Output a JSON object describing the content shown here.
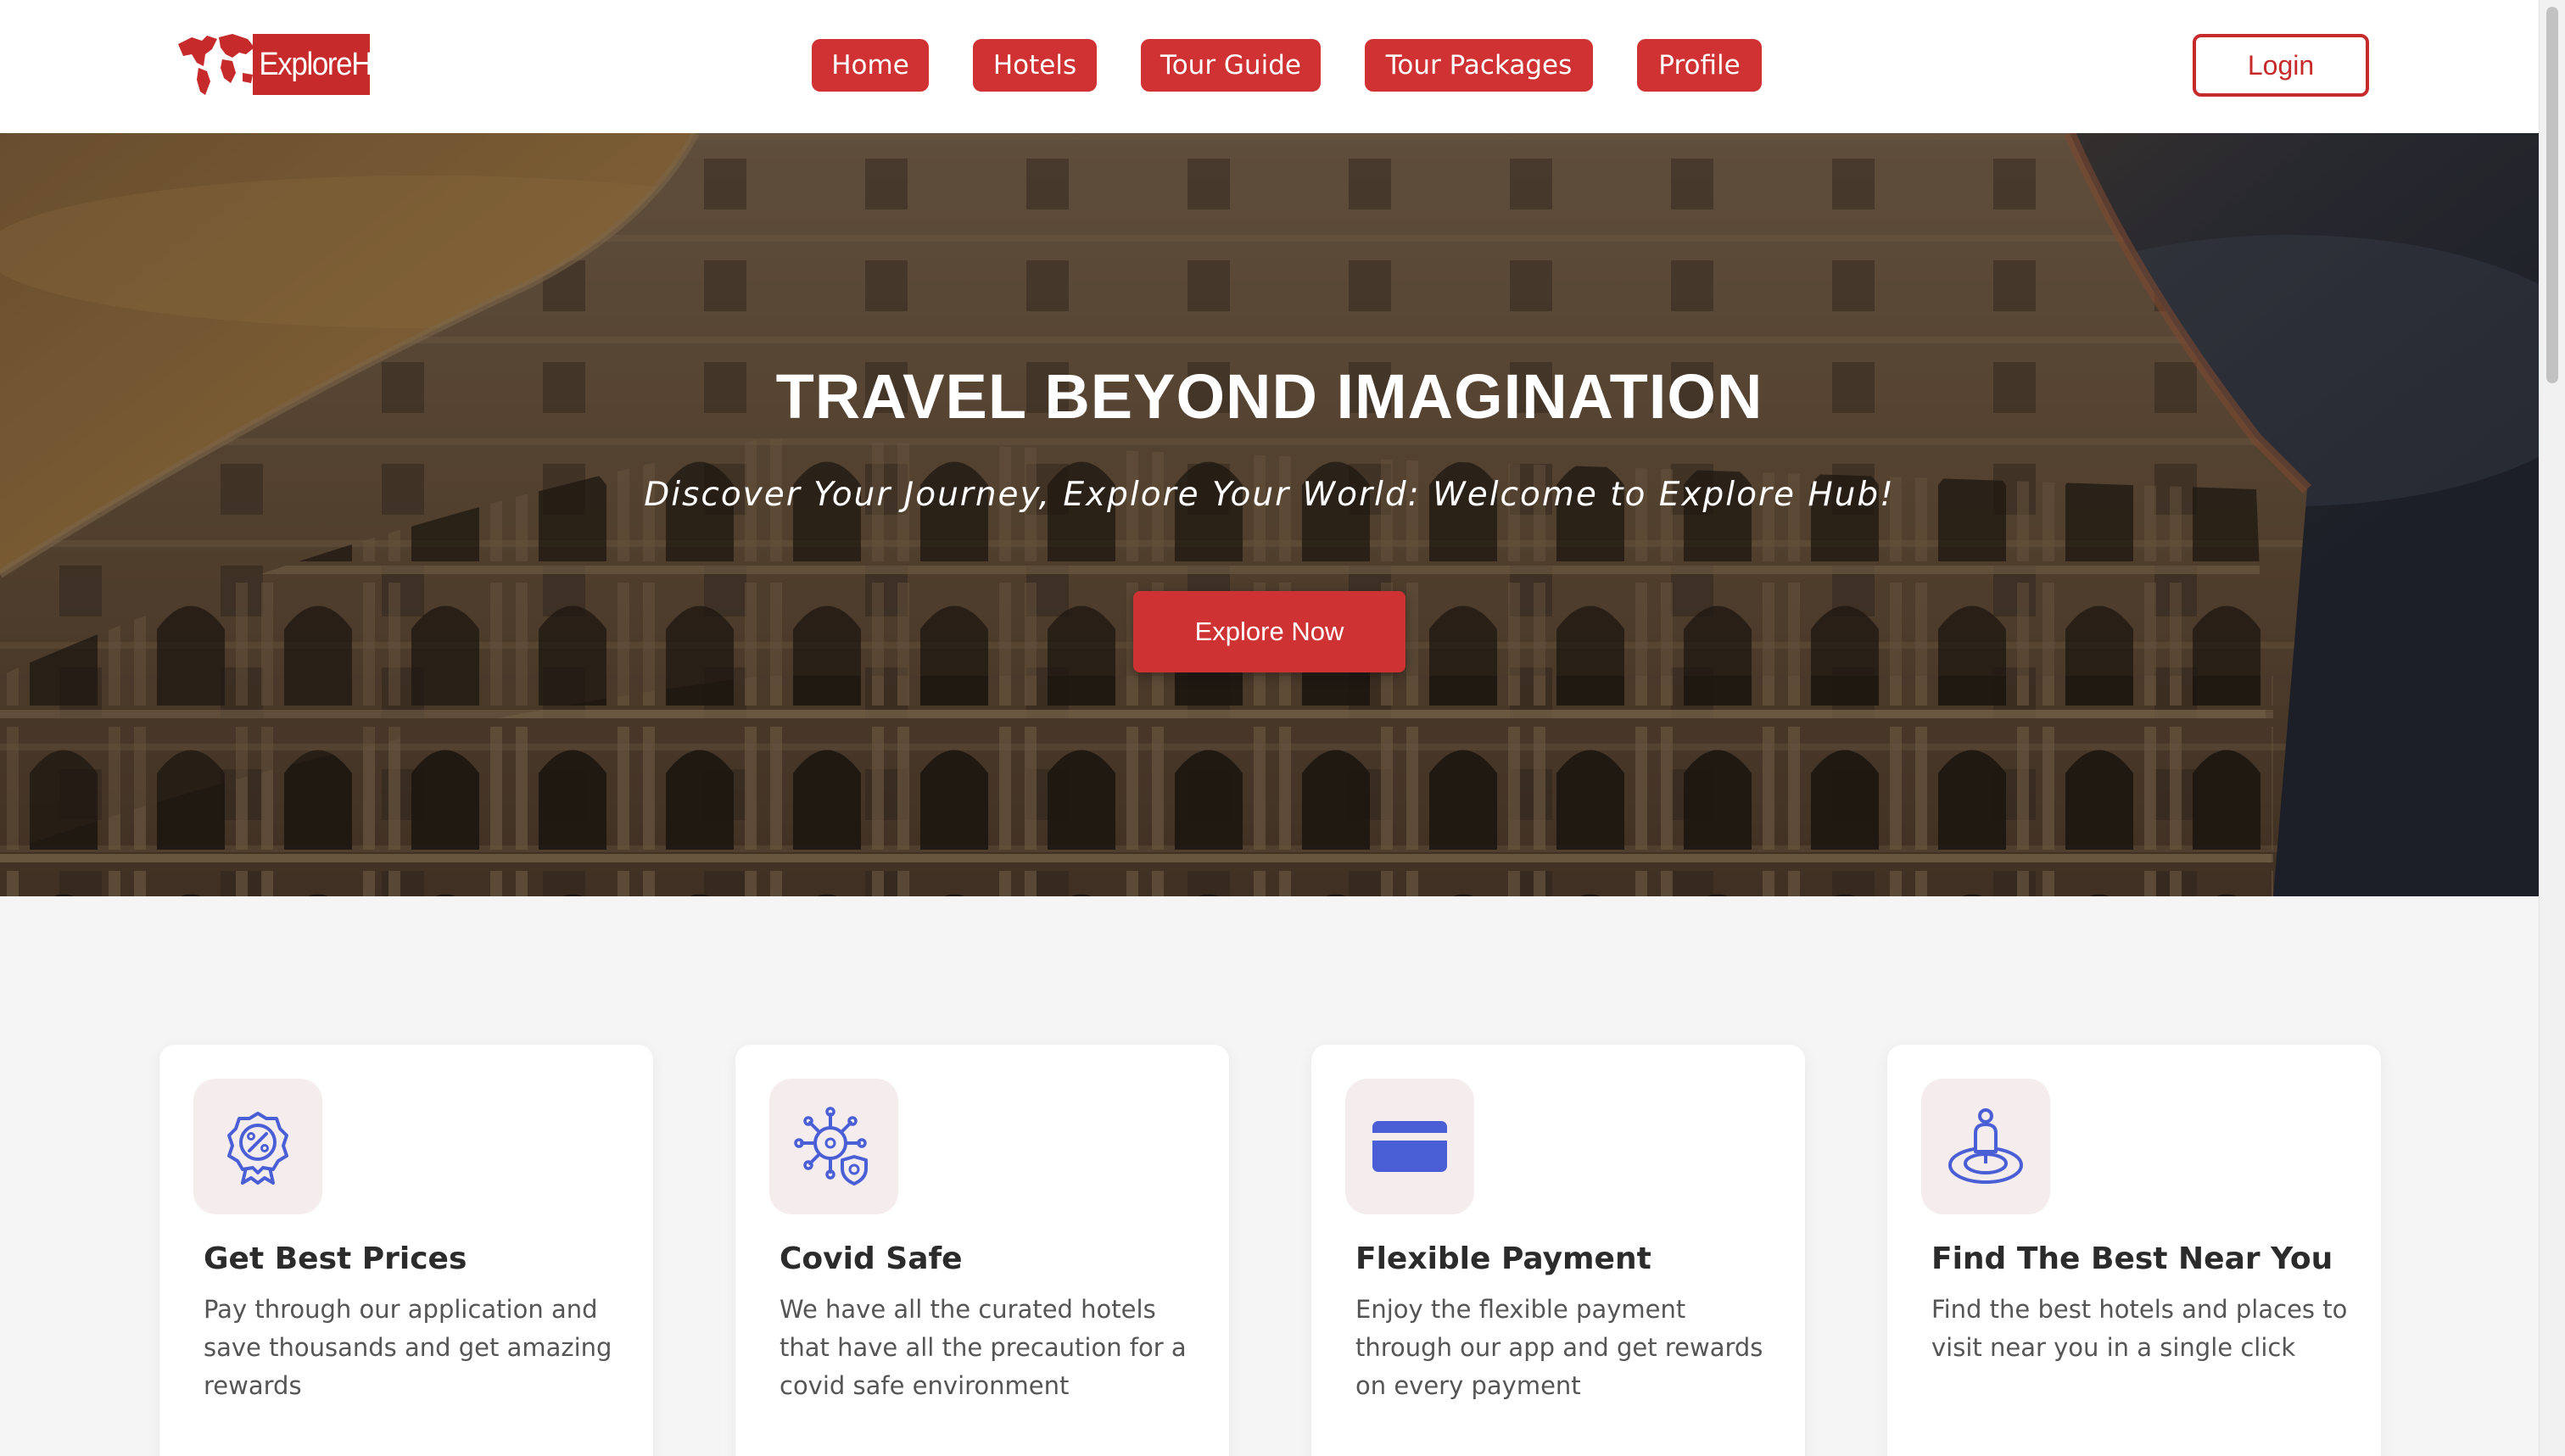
{
  "brand": {
    "logo_text": "ExploreHub",
    "accent": "#d03132"
  },
  "nav": {
    "items": [
      {
        "label": "Home"
      },
      {
        "label": "Hotels"
      },
      {
        "label": "Tour Guide"
      },
      {
        "label": "Tour Packages"
      },
      {
        "label": "Profile"
      }
    ],
    "login_label": "Login"
  },
  "hero": {
    "title": "TRAVEL BEYOND IMAGINATION",
    "subtitle": "Discover Your Journey, Explore Your World: Welcome to Explore Hub!",
    "cta_label": "Explore Now"
  },
  "features": [
    {
      "icon": "discount-badge-icon",
      "title": "Get Best Prices",
      "description": "Pay through our application and save thousands and get amazing rewards"
    },
    {
      "icon": "virus-shield-icon",
      "title": "Covid Safe",
      "description": "We have all the curated hotels that have all the precaution for a covid safe environment"
    },
    {
      "icon": "credit-card-icon",
      "title": "Flexible Payment",
      "description": "Enjoy the flexible payment through our app and get rewards on every payment"
    },
    {
      "icon": "location-person-icon",
      "title": "Find The Best Near You",
      "description": "Find the best hotels and places to visit near you in a single click"
    }
  ]
}
